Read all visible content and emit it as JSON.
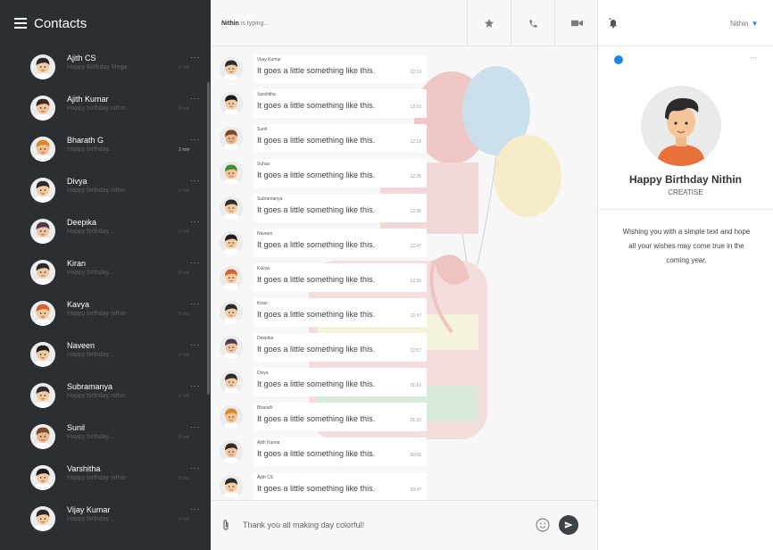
{
  "sidebar": {
    "title": "Contacts",
    "contacts": [
      {
        "name": "Ajith CS",
        "message": "Happy Birthday Mega",
        "time": "8 min",
        "skin": "#f3c9a0",
        "hair": "#2a2a2a"
      },
      {
        "name": "Ajith Kumar",
        "message": "Happy birthday nithin",
        "time": "8 min",
        "skin": "#f1c59b",
        "hair": "#3a2a1f"
      },
      {
        "name": "Bharath G",
        "message": "Happy birthday...",
        "time": "2 min",
        "skin": "#f2c192",
        "hair": "#d48b2b"
      },
      {
        "name": "Divya",
        "message": "Happy birthday nithin",
        "time": "8 min",
        "skin": "#f3c9a0",
        "hair": "#2b2b2b"
      },
      {
        "name": "Deepika",
        "message": "Happy birthday...",
        "time": "8 min",
        "skin": "#f1c3a5",
        "hair": "#4a3b4d"
      },
      {
        "name": "Kiran",
        "message": "Happy birthday...",
        "time": "8 min",
        "skin": "#f3c9a0",
        "hair": "#2a2a2a"
      },
      {
        "name": "Kavya",
        "message": "Happy birthday nithin",
        "time": "8 min",
        "skin": "#f3c9a0",
        "hair": "#d1622a"
      },
      {
        "name": "Naveen",
        "message": "Happy birthday...",
        "time": "8 min",
        "skin": "#f3c9a0",
        "hair": "#1f1f1f"
      },
      {
        "name": "Subramanya",
        "message": "Happy birthday nithin",
        "time": "8 min",
        "skin": "#f3c9a0",
        "hair": "#2d2d2d"
      },
      {
        "name": "Sunil",
        "message": "Happy birthday...",
        "time": "8 min",
        "skin": "#e9b58a",
        "hair": "#7a4a22"
      },
      {
        "name": "Varshitha",
        "message": "Happy birthday nithin",
        "time": "8 min",
        "skin": "#f3c9a0",
        "hair": "#1c1c1c"
      },
      {
        "name": "Vijay Kumar",
        "message": "Happy birthday...",
        "time": "8 min",
        "skin": "#f3c9a0",
        "hair": "#2a2a2a"
      }
    ],
    "more_glyph": "···"
  },
  "chat": {
    "typing_name": "Nithin",
    "typing_text": " is typing...",
    "messages": [
      {
        "sender": "Vijay Kumar",
        "text": "It goes a little something like this.",
        "time": "12:10",
        "skin": "#f3c9a0",
        "hair": "#2a2a2a"
      },
      {
        "sender": "Varshitha",
        "text": "It goes a little something like this.",
        "time": "12:15",
        "skin": "#f3c9a0",
        "hair": "#1c1c1c"
      },
      {
        "sender": "Sunil",
        "text": "It goes a little something like this.",
        "time": "12:18",
        "skin": "#e9b58a",
        "hair": "#7a4a22"
      },
      {
        "sender": "Suhas",
        "text": "It goes a little something like this.",
        "time": "12:25",
        "skin": "#f2c192",
        "hair": "#3c8f2e"
      },
      {
        "sender": "Subramanya",
        "text": "It goes a little something like this.",
        "time": "12:30",
        "skin": "#f3c9a0",
        "hair": "#2d2d2d"
      },
      {
        "sender": "Naveen",
        "text": "It goes a little something like this.",
        "time": "12:47",
        "skin": "#f3c9a0",
        "hair": "#1f1f1f"
      },
      {
        "sender": "Kavya",
        "text": "It goes a little something like this.",
        "time": "12:55",
        "skin": "#f3c9a0",
        "hair": "#d1622a"
      },
      {
        "sender": "Kiran",
        "text": "It goes a little something like this.",
        "time": "12:47",
        "skin": "#f3c9a0",
        "hair": "#2a2a2a"
      },
      {
        "sender": "Deepika",
        "text": "It goes a little something like this.",
        "time": "12:57",
        "skin": "#f1c3a5",
        "hair": "#4a3b4d"
      },
      {
        "sender": "Divya",
        "text": "It goes a little something like this.",
        "time": "01:10",
        "skin": "#f3c9a0",
        "hair": "#2b2b2b"
      },
      {
        "sender": "Bharath",
        "text": "It goes a little something like this.",
        "time": "01:30",
        "skin": "#f2c192",
        "hair": "#d48b2b"
      },
      {
        "sender": "Ajith Kumar",
        "text": "It goes a little something like this.",
        "time": "09:00",
        "skin": "#f1c59b",
        "hair": "#3a2a1f"
      },
      {
        "sender": "Ajith CS",
        "text": "It goes a little something like this.",
        "time": "09:47",
        "skin": "#f3c9a0",
        "hair": "#2a2a2a"
      }
    ],
    "composer": {
      "value": "Thank you all making day colorful!"
    }
  },
  "panel": {
    "user": "Nithin",
    "title": "Happy Birthday Nithin",
    "subtitle": "CREATISE",
    "wish": "Wishing you with a simple text and hope all your wishes may come true in the coming year."
  },
  "colors": {
    "sidebar": "#2b2f33",
    "accent": "#1e88e5",
    "send": "#3d4349"
  }
}
